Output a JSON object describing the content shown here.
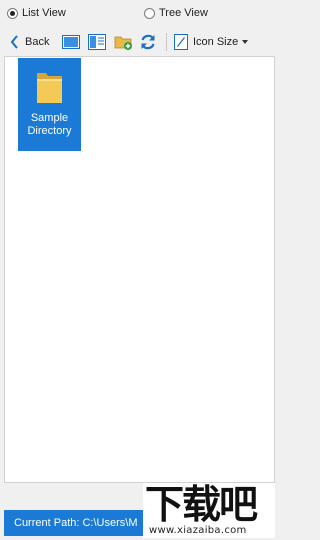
{
  "view_options": {
    "list_view_label": "List View",
    "tree_view_label": "Tree View",
    "selected": "List View"
  },
  "toolbar": {
    "back_label": "Back",
    "icon_size_label": "Icon Size"
  },
  "items": [
    {
      "name": "Sample Directory",
      "type": "folder",
      "selected": true
    }
  ],
  "status": {
    "current_path": "Current Path: C:\\Users\\M"
  },
  "watermark": {
    "logo_text": "下载吧",
    "url": "www.xiazaiba.com"
  },
  "colors": {
    "selection": "#1a7ad6",
    "toolbar_icon": "#1a6fc4",
    "folder": "#f5c955"
  }
}
